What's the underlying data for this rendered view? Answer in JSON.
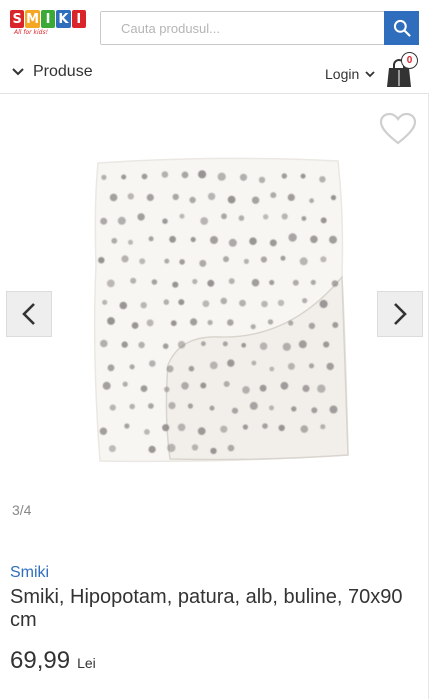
{
  "logo": {
    "letters": [
      "S",
      "M",
      "I",
      "K",
      "I"
    ],
    "colors": [
      "#d9252a",
      "#f5a623",
      "#3aa935",
      "#2f6ebd",
      "#d9252a"
    ],
    "tagline": "All for kids!"
  },
  "search": {
    "placeholder": "Cauta produsul...",
    "button_icon": "search-icon"
  },
  "nav": {
    "products_label": "Produse",
    "login_label": "Login",
    "cart_count": "0"
  },
  "gallery": {
    "counter": "3/4"
  },
  "product": {
    "brand": "Smiki",
    "title": "Smiki, Hipopotam, patura, alb, buline, 70x90 cm",
    "price": "69,99",
    "currency": "Lei"
  },
  "colors": {
    "accent": "#2f6ebd",
    "badge": "#d9252a",
    "text": "#333333"
  }
}
